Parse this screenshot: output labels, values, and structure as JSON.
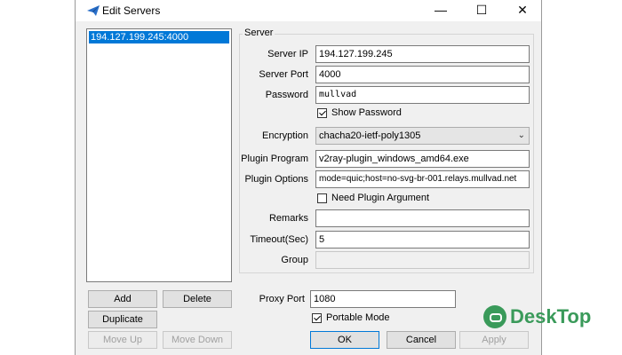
{
  "window": {
    "title": "Edit Servers",
    "minimize_symbol": "—",
    "maximize_symbol": "☐",
    "close_symbol": "✕"
  },
  "server_list": {
    "items": [
      "194.127.199.245:4000"
    ],
    "selected_index": 0
  },
  "server_group": {
    "legend": "Server",
    "server_ip": {
      "label": "Server IP",
      "value": "194.127.199.245"
    },
    "server_port": {
      "label": "Server Port",
      "value": "4000"
    },
    "password": {
      "label": "Password",
      "value": "mullvad"
    },
    "show_password": {
      "label": "Show Password",
      "checked": true
    },
    "encryption": {
      "label": "Encryption",
      "value": "chacha20-ietf-poly1305"
    },
    "plugin_program": {
      "label": "Plugin Program",
      "value": "v2ray-plugin_windows_amd64.exe"
    },
    "plugin_options": {
      "label": "Plugin Options",
      "value": "mode=quic;host=no-svg-br-001.relays.mullvad.net"
    },
    "need_plugin_argument": {
      "label": "Need Plugin Argument",
      "checked": false
    },
    "remarks": {
      "label": "Remarks",
      "value": ""
    },
    "timeout": {
      "label": "Timeout(Sec)",
      "value": "5"
    },
    "group": {
      "label": "Group",
      "value": ""
    }
  },
  "list_buttons": {
    "add": "Add",
    "delete": "Delete",
    "duplicate": "Duplicate",
    "move_up": "Move Up",
    "move_down": "Move Down"
  },
  "proxy_port": {
    "label": "Proxy Port",
    "value": "1080"
  },
  "portable_mode": {
    "label": "Portable Mode",
    "checked": true
  },
  "dialog_buttons": {
    "ok": "OK",
    "cancel": "Cancel",
    "apply": "Apply"
  },
  "watermark": {
    "text": "DeskTop"
  },
  "colors": {
    "selection": "#0078d7",
    "dialog_bg": "#f0f0f0",
    "watermark": "#3a9a5a"
  }
}
